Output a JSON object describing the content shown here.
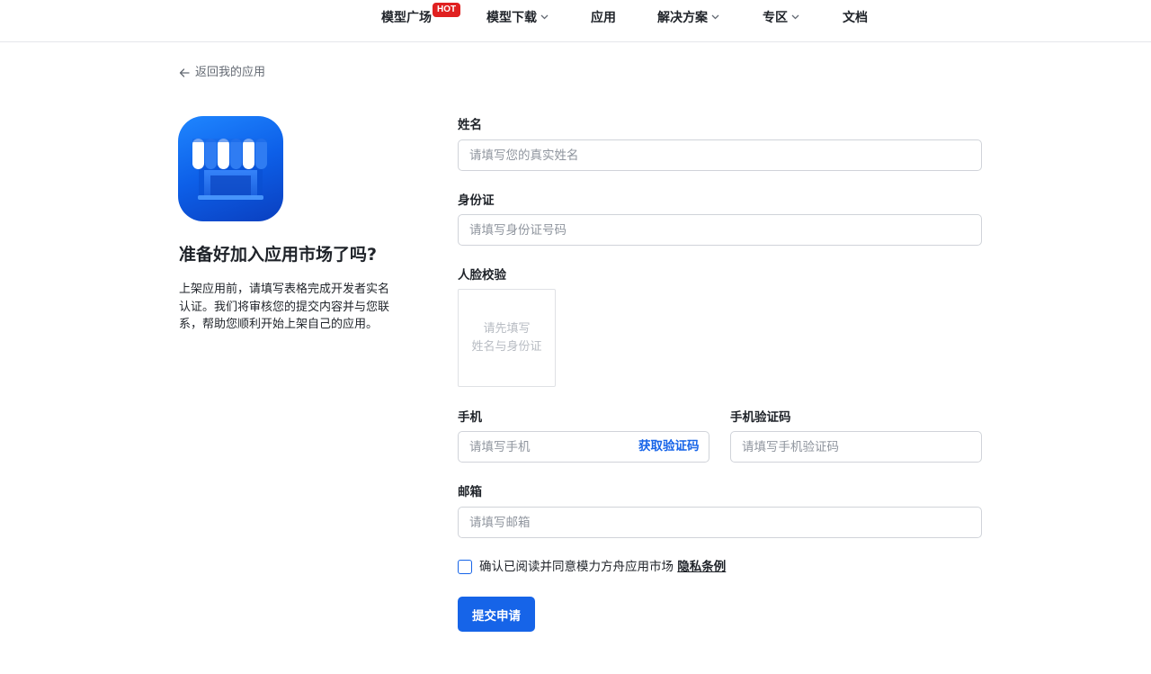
{
  "nav": {
    "items": [
      {
        "label": "模型广场",
        "has_dropdown": false
      },
      {
        "label": "模型下载",
        "has_dropdown": true
      },
      {
        "label": "应用",
        "has_dropdown": false
      },
      {
        "label": "解决方案",
        "has_dropdown": true
      },
      {
        "label": "专区",
        "has_dropdown": true
      },
      {
        "label": "文档",
        "has_dropdown": false
      }
    ],
    "hot_badge": "HOT"
  },
  "back_link": {
    "label": "返回我的应用",
    "icon": "arrow-left-icon"
  },
  "intro": {
    "app_icon": "storefront-icon",
    "headline": "准备好加入应用市场了吗?",
    "description": "上架应用前，请填写表格完成开发者实名认证。我们将审核您的提交内容并与您联系，帮助您顺利开始上架自己的应用。"
  },
  "form": {
    "name": {
      "label": "姓名",
      "value": "",
      "placeholder": "请填写您的真实姓名"
    },
    "id_card": {
      "label": "身份证",
      "value": "",
      "placeholder": "请填写身份证号码"
    },
    "face_check": {
      "label": "人脸校验",
      "line1": "请先填写",
      "line2": "姓名与身份证"
    },
    "phone": {
      "label": "手机",
      "value": "",
      "placeholder": "请填写手机",
      "get_code_label": "获取验证码"
    },
    "sms_code": {
      "label": "手机验证码",
      "value": "",
      "placeholder": "请填写手机验证码"
    },
    "email": {
      "label": "邮箱",
      "value": "",
      "placeholder": "请填写邮箱"
    },
    "agreement": {
      "checked": false,
      "text": "确认已阅读并同意模力方舟应用市场 ",
      "link": "隐私条例"
    },
    "submit_label": "提交申请"
  },
  "colors": {
    "accent": "#1664e8",
    "hot": "#e02020"
  }
}
